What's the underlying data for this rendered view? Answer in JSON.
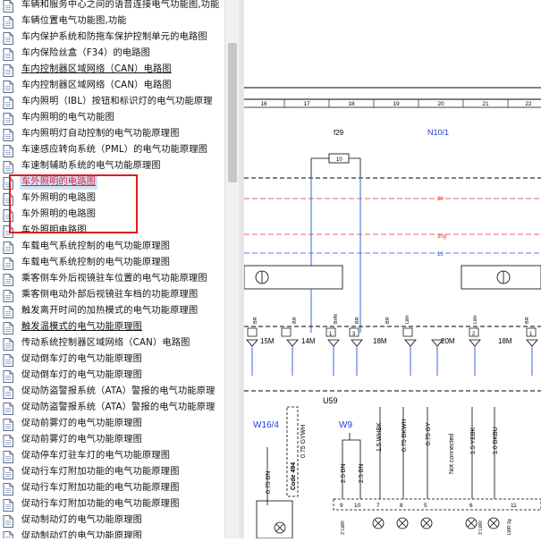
{
  "tree": {
    "items": [
      {
        "label": "车辆和服务中心之间的语音连接电气功能图,功能",
        "style": "normal"
      },
      {
        "label": "车辆位置电气功能图,功能",
        "style": "normal"
      },
      {
        "label": "车内保护系统和防拖车保护控制单元的电路图",
        "style": "normal"
      },
      {
        "label": "车内保险丝盒（F34）的电路图",
        "style": "normal"
      },
      {
        "label": "车内控制器区域网络（CAN）电路图",
        "style": "underline"
      },
      {
        "label": "车内控制器区域网络（CAN）电路图",
        "style": "normal"
      },
      {
        "label": "车内照明（IBL）按钮和标识灯的电气功能原理",
        "style": "normal"
      },
      {
        "label": "车内照明的电气功能图",
        "style": "normal"
      },
      {
        "label": "车内照明灯自动控制的电气功能原理图",
        "style": "normal"
      },
      {
        "label": "车速感应转向系统（PML）的电气功能原理图",
        "style": "normal"
      },
      {
        "label": "车速制辅助系统的电气功能原理图",
        "style": "normal"
      },
      {
        "label": "车外照明的电路图",
        "style": "highlight"
      },
      {
        "label": "车外照明的电路图",
        "style": "normal"
      },
      {
        "label": "车外照明的电路图",
        "style": "normal"
      },
      {
        "label": "车外照明电路图",
        "style": "normal"
      },
      {
        "label": "车载电气系统控制的电气功能原理图",
        "style": "normal"
      },
      {
        "label": "车载电气系统控制的电气功能原理图",
        "style": "normal"
      },
      {
        "label": "乘客侧车外后视镜驻车位置的电气功能原理图",
        "style": "normal"
      },
      {
        "label": "乘客侧电动外部后视镜驻车档的功能原理图",
        "style": "normal"
      },
      {
        "label": "触发离开时间的加热模式的电气功能原理图",
        "style": "normal"
      },
      {
        "label": "触发温模式的电气功能原理图",
        "style": "underline"
      },
      {
        "label": "传动系统控制器区域网络（CAN）电路图",
        "style": "normal"
      },
      {
        "label": "促动倒车灯的电气功能原理图",
        "style": "normal"
      },
      {
        "label": "促动倒车灯的电气功能原理图",
        "style": "normal"
      },
      {
        "label": "促动防盗警报系统（ATA）警报的电气功能原理",
        "style": "normal"
      },
      {
        "label": "促动防盗警报系统（ATA）警报的电气功能原理",
        "style": "normal"
      },
      {
        "label": "促动前雾灯的电气功能原理图",
        "style": "normal"
      },
      {
        "label": "促动前雾灯的电气功能原理图",
        "style": "normal"
      },
      {
        "label": "促动停车灯驻车灯的电气功能原理图",
        "style": "normal"
      },
      {
        "label": "促动行车灯附加功能的电气功能原理图",
        "style": "normal"
      },
      {
        "label": "促动行车灯附加功能的电气功能原理图",
        "style": "normal"
      },
      {
        "label": "促动行车灯附加功能的电气功能原理图",
        "style": "normal"
      },
      {
        "label": "促动制动灯的电气功能原理图",
        "style": "normal"
      },
      {
        "label": "促动制动灯的电气功能原理图",
        "style": "normal"
      }
    ]
  },
  "diagram": {
    "column_numbers": [
      "16",
      "17",
      "18",
      "19",
      "20",
      "21",
      "22"
    ],
    "fuse_label": "f29",
    "fuse_value": "10",
    "module_label": "N10/1",
    "bus_labels": [
      "30",
      "30g",
      "15"
    ],
    "pin_numbers": [
      "1",
      "2",
      "3",
      "4",
      "2",
      "1"
    ],
    "wire_vertical_labels": [
      "BR",
      "BR",
      "BrRt",
      "BR",
      "BR",
      "LWr",
      "LWr",
      "BR"
    ],
    "ground_labels": [
      "15M",
      "14M",
      "18M",
      "20M",
      "18M"
    ],
    "connector_label": "U59",
    "left_ref": "W16/4",
    "mid_ref": "W9",
    "wires": [
      "0.75 BN",
      "Code 494",
      "0.75 GYWH",
      "2.5 BN",
      "2.5 BN",
      "1.5 WHBK",
      "0.75 BKWH",
      "0.75 GY",
      "Not connected",
      "1.5 YEBK",
      "1.0 BKBU"
    ],
    "bottom_pins": [
      "9",
      "10",
      "7",
      "8",
      "5",
      "6",
      "11"
    ],
    "bottom_small_labels": [
      "3' LWR",
      "3' LWR",
      "LWR 9g"
    ]
  },
  "colors": {
    "highlight_text": "#d9233b",
    "highlight_bg": "#cfe3f7",
    "frame": "#e21b1b",
    "wire_blue": "#2a55d4",
    "bus_red": "#e03030"
  }
}
